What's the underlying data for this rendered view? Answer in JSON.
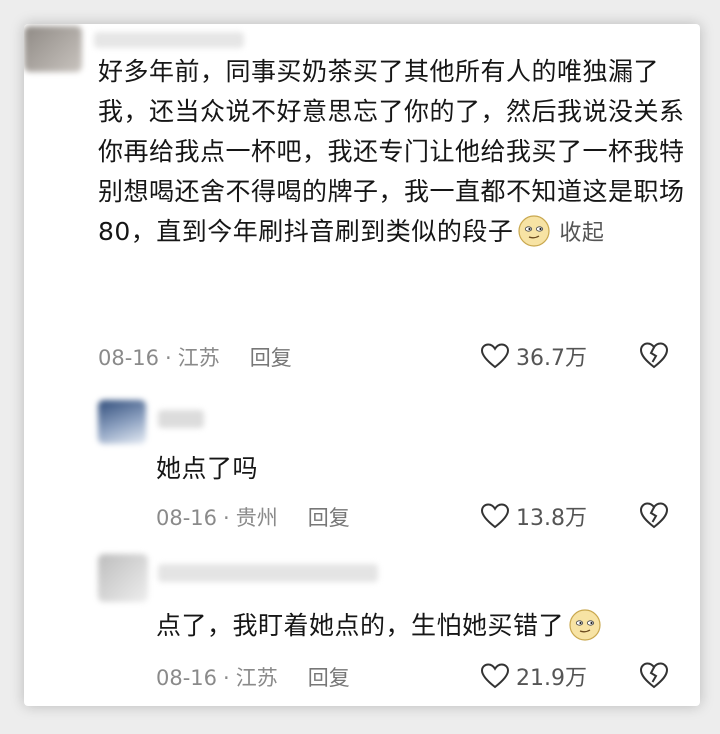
{
  "main_comment": {
    "text": "好多年前，同事买奶茶买了其他所有人的唯独漏了我，还当众说不好意思忘了你的了，然后我说没关系你再给我点一杯吧，我还专门让他给我买了一杯我特别想喝还舍不得喝的牌子，我一直都不知道这是职场80，直到今年刷抖音刷到类似的段子",
    "collapse_label": "收起",
    "date": "08-16",
    "separator": "·",
    "location": "江苏",
    "reply_label": "回复",
    "likes": "36.7万"
  },
  "replies": [
    {
      "text": "她点了吗",
      "date": "08-16",
      "separator": "·",
      "location": "贵州",
      "reply_label": "回复",
      "likes": "13.8万"
    },
    {
      "text": "点了，我盯着她点的，生怕她买错了",
      "date": "08-16",
      "separator": "·",
      "location": "江苏",
      "reply_label": "回复",
      "likes": "21.9万"
    }
  ],
  "colors": {
    "text": "#161616",
    "meta": "#8a8a8a",
    "background": "#ffffff"
  },
  "icons": [
    "heart-outline-icon",
    "broken-heart-icon",
    "sly-smile-emoji"
  ]
}
